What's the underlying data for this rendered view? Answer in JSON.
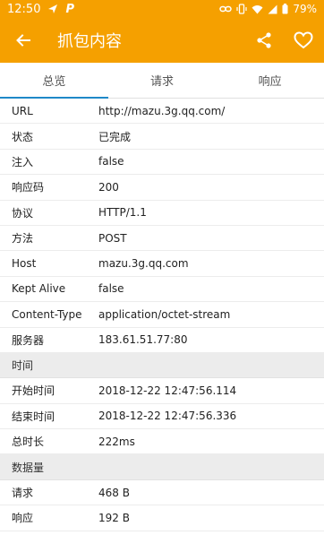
{
  "status_bar": {
    "time": "12:50",
    "battery": "79%"
  },
  "app_bar": {
    "title": "抓包内容",
    "accent_color": "#f5a000"
  },
  "tabs": [
    {
      "label": "总览",
      "active": true
    },
    {
      "label": "请求",
      "active": false
    },
    {
      "label": "响应",
      "active": false
    }
  ],
  "overview": {
    "rows": [
      {
        "key": "URL",
        "value": "http://mazu.3g.qq.com/"
      },
      {
        "key": "状态",
        "value": "已完成"
      },
      {
        "key": "注入",
        "value": "false"
      },
      {
        "key": "响应码",
        "value": "200"
      },
      {
        "key": "协议",
        "value": "HTTP/1.1"
      },
      {
        "key": "方法",
        "value": "POST"
      },
      {
        "key": "Host",
        "value": "mazu.3g.qq.com"
      },
      {
        "key": "Kept Alive",
        "value": "false"
      },
      {
        "key": "Content-Type",
        "value": "application/octet-stream"
      },
      {
        "key": "服务器",
        "value": "183.61.51.77:80"
      }
    ],
    "time_section": "时间",
    "time_rows": [
      {
        "key": "开始时间",
        "value": "2018-12-22 12:47:56.114"
      },
      {
        "key": "结束时间",
        "value": "2018-12-22 12:47:56.336"
      },
      {
        "key": "总时长",
        "value": "222ms"
      }
    ],
    "size_section": "数据量",
    "size_rows": [
      {
        "key": "请求",
        "value": "468 B"
      },
      {
        "key": "响应",
        "value": "192 B"
      }
    ]
  }
}
